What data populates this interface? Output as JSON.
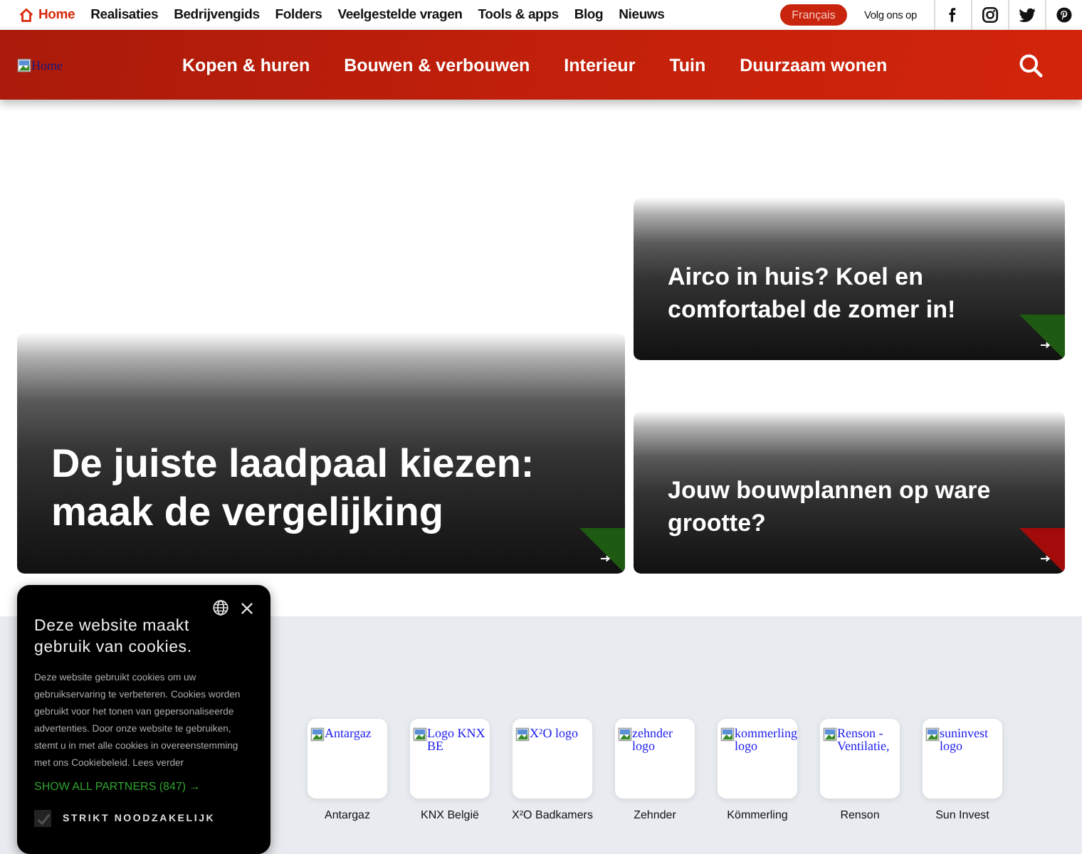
{
  "top_nav": {
    "items": [
      {
        "label": "Home",
        "selected": true
      },
      {
        "label": "Realisaties",
        "selected": false
      },
      {
        "label": "Bedrijvengids",
        "selected": false
      },
      {
        "label": "Folders",
        "selected": false
      },
      {
        "label": "Veelgestelde vragen",
        "selected": false
      },
      {
        "label": "Tools & apps",
        "selected": false
      },
      {
        "label": "Blog",
        "selected": false
      },
      {
        "label": "Nieuws",
        "selected": false
      }
    ],
    "language_button": "Français",
    "follow_label": "Volg ons op",
    "social": [
      {
        "kind": "facebook"
      },
      {
        "kind": "instagram"
      },
      {
        "kind": "twitter"
      },
      {
        "kind": "pinterest"
      }
    ]
  },
  "main_nav": {
    "logo_alt": "Home",
    "items": [
      "Kopen & huren",
      "Bouwen & verbouwen",
      "Interieur",
      "Tuin",
      "Duurzaam wonen"
    ]
  },
  "featured": [
    {
      "title": "De juiste laadpaal kiezen: maak de vergelijking",
      "color": "#1f5a12",
      "kind": "large"
    },
    {
      "title": "Airco in huis? Koel en comfortabel de zomer in!",
      "color": "#1f5a12",
      "kind": "small"
    },
    {
      "title": "Jouw bouwplannen op ware grootte?",
      "color": "#a30a0a",
      "kind": "small"
    }
  ],
  "partners": [
    {
      "alt": "Antargaz",
      "name": "Antargaz"
    },
    {
      "alt": "Logo KNX BE",
      "name": "KNX België"
    },
    {
      "alt": "X²O logo",
      "name": "X²O Badkamers"
    },
    {
      "alt": "zehnder logo",
      "name": "Zehnder"
    },
    {
      "alt": "kommerling logo",
      "name": "Kömmerling"
    },
    {
      "alt": "Renson - Ventilatie,",
      "name": "Renson"
    },
    {
      "alt": "suninvest logo",
      "name": "Sun Invest"
    }
  ],
  "cookie_banner": {
    "title": "Deze website maakt gebruik van cookies.",
    "body": "Deze website gebruikt cookies om uw gebruikservaring te verbeteren. Cookies worden gebruikt voor het tonen van gepersonaliseerde advertenties. Door onze website te gebruiken, stemt u in met alle cookies in overeenstemming met ons Cookiebeleid.",
    "more_link": "Lees verder",
    "partners_link": "SHOW ALL PARTNERS (847) →",
    "options": [
      {
        "label": "STRIKT NOODZAKELIJK",
        "checked": true,
        "disabled": true
      }
    ]
  }
}
